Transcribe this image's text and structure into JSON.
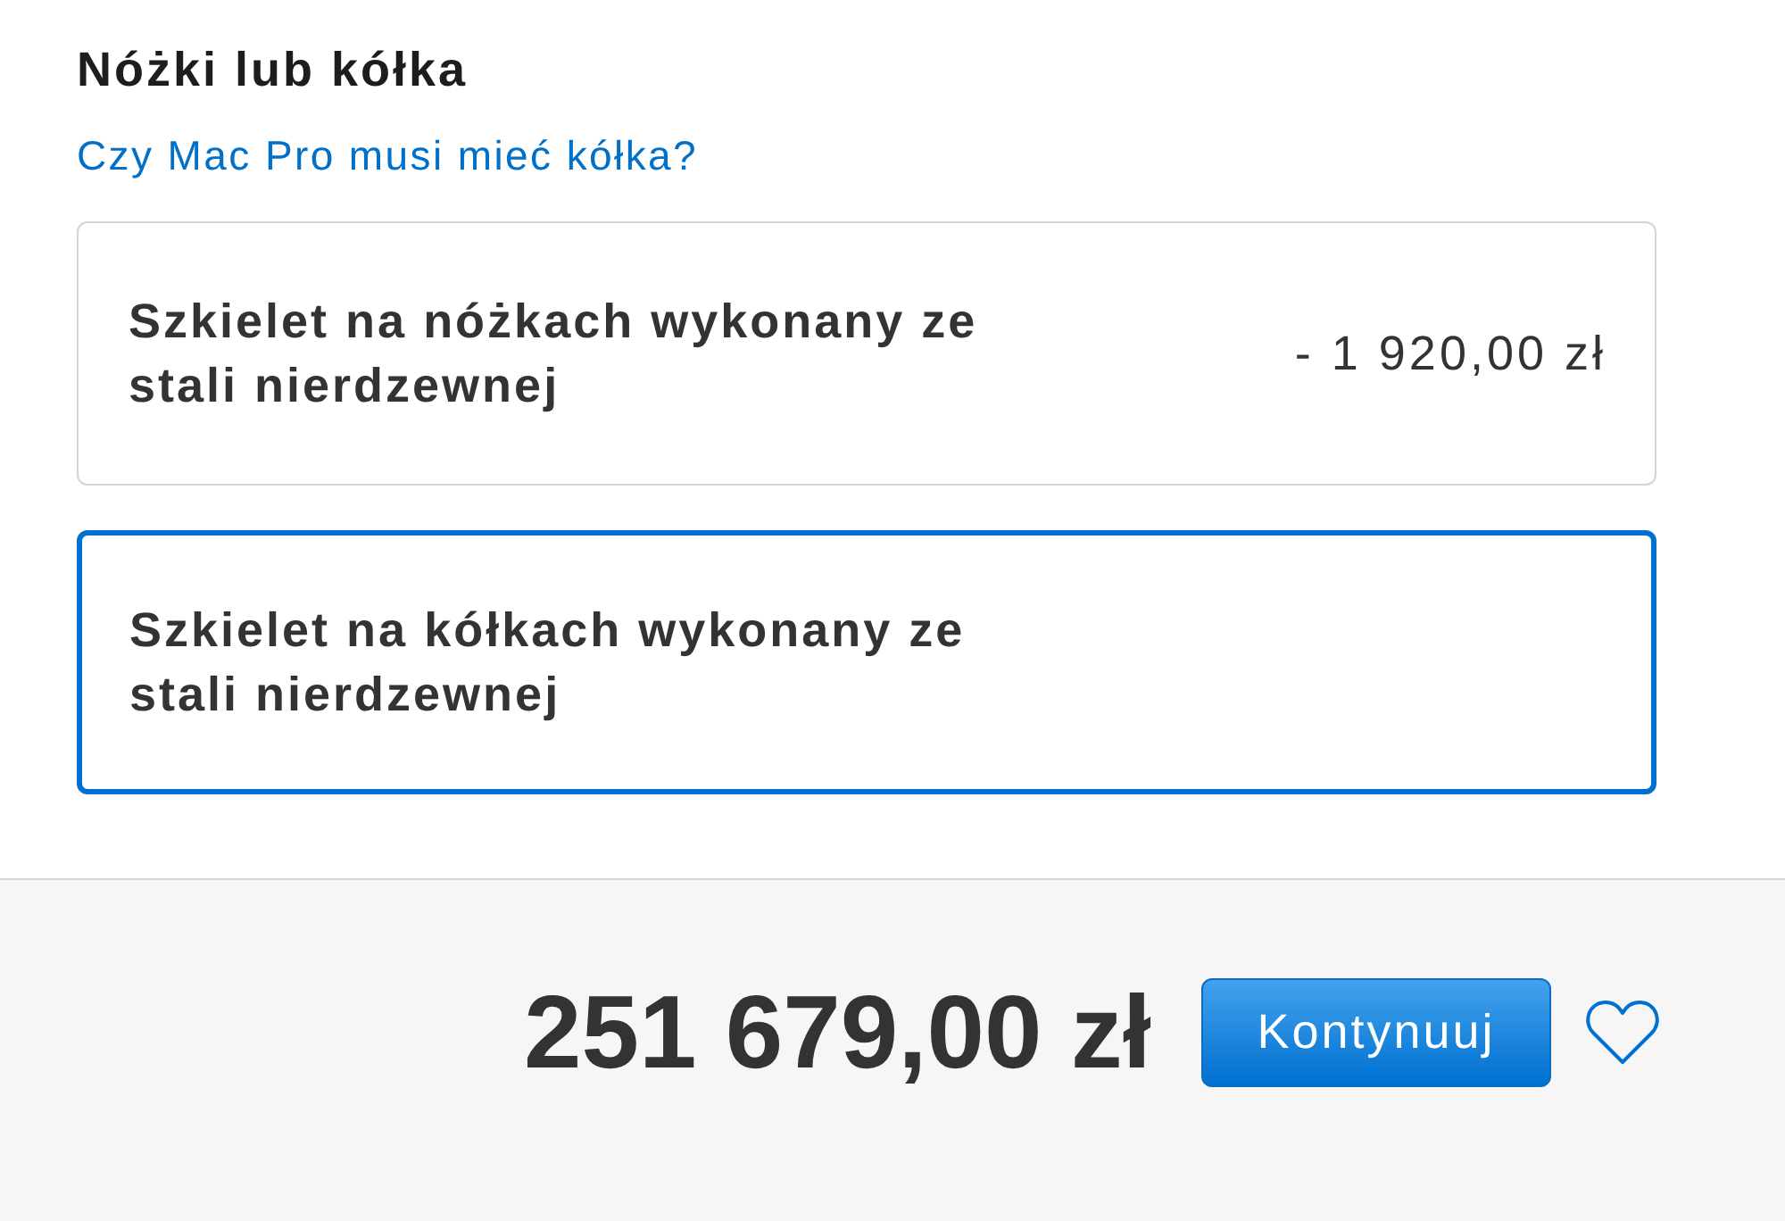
{
  "section": {
    "title": "Nóżki lub kółka",
    "help_link": "Czy Mac Pro musi mieć kółka?"
  },
  "options": [
    {
      "label": "Szkielet na nóżkach wykonany ze stali nierdzewnej",
      "price": "- 1 920,00 zł",
      "selected": false
    },
    {
      "label": "Szkielet na kółkach wykonany ze stali nierdzewnej",
      "selected": true
    }
  ],
  "summary": {
    "total": "251 679,00 zł",
    "continue_button": "Kontynuuj"
  }
}
